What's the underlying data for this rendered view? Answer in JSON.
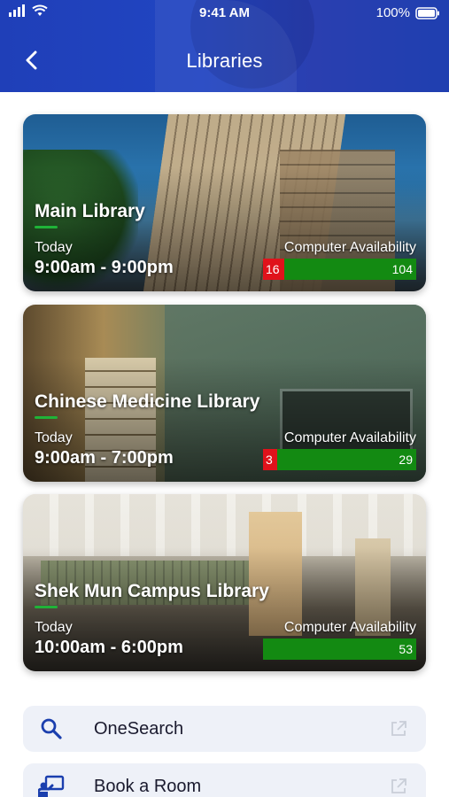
{
  "status_bar": {
    "time": "9:41 AM",
    "battery": "100%"
  },
  "header": {
    "title": "Libraries",
    "back_icon": "chevron-left-icon"
  },
  "libraries": [
    {
      "name": "Main Library",
      "today_label": "Today",
      "hours": "9:00am - 9:00pm",
      "computer_label": "Computer Availability",
      "in_use": "16",
      "available": "104"
    },
    {
      "name": "Chinese Medicine Library",
      "today_label": "Today",
      "hours": "9:00am - 7:00pm",
      "computer_label": "Computer Availability",
      "in_use": "3",
      "available": "29"
    },
    {
      "name": "Shek Mun Campus Library",
      "today_label": "Today",
      "hours": "10:00am - 6:00pm",
      "computer_label": "Computer Availability",
      "in_use": "",
      "available": "53"
    }
  ],
  "menu": [
    {
      "label": "OneSearch",
      "icon": "search-icon",
      "external_icon": "external-link-icon"
    },
    {
      "label": "Book a Room",
      "icon": "presentation-icon",
      "external_icon": "external-link-icon"
    }
  ],
  "colors": {
    "header": "#2145c2",
    "in_use": "#e0121b",
    "available": "#138a12",
    "accent_underline": "#1fb338",
    "menu_bg": "#eef1f8",
    "icon_blue": "#1b3fae"
  }
}
